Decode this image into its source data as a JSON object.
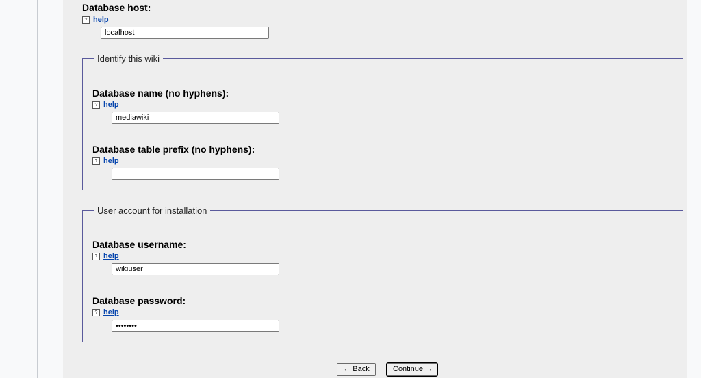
{
  "form": {
    "db_host": {
      "label": "Database host:",
      "help": "help",
      "value": "localhost"
    },
    "identify_wiki": {
      "legend": "Identify this wiki",
      "db_name": {
        "label": "Database name (no hyphens):",
        "help": "help",
        "value": "mediawiki"
      },
      "table_prefix": {
        "label": "Database table prefix (no hyphens):",
        "help": "help",
        "value": ""
      }
    },
    "install_account": {
      "legend": "User account for installation",
      "username": {
        "label": "Database username:",
        "help": "help",
        "value": "wikiuser"
      },
      "password": {
        "label": "Database password:",
        "help": "help",
        "value": "password"
      }
    }
  },
  "buttons": {
    "back": "← Back",
    "continue": "Continue →"
  },
  "icons": {
    "help": "help-icon"
  }
}
